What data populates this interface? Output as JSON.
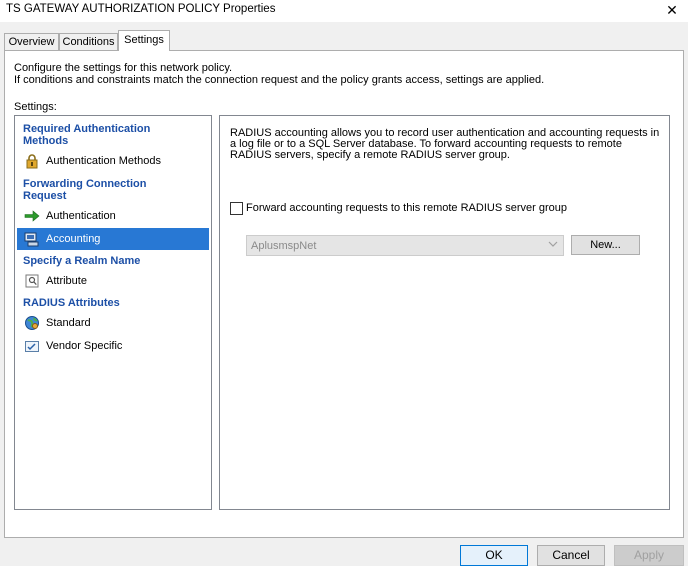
{
  "window": {
    "title": "TS GATEWAY AUTHORIZATION POLICY Properties",
    "close_glyph": "✕"
  },
  "tabs": [
    {
      "label": "Overview"
    },
    {
      "label": "Conditions"
    },
    {
      "label": "Settings",
      "active": true
    }
  ],
  "settings_page": {
    "description_line1": "Configure the settings for this network policy.",
    "description_line2": "If conditions and constraints match the connection request and the policy grants access, settings are applied.",
    "settings_label": "Settings:"
  },
  "sidebar": {
    "groups": [
      {
        "label_line1": "Required Authentication",
        "label_line2": "Methods"
      },
      {
        "label_line1": "Forwarding Connection",
        "label_line2": "Request"
      },
      {
        "label": "Specify a Realm Name"
      },
      {
        "label": "RADIUS Attributes"
      }
    ],
    "items": [
      {
        "label": "Authentication Methods",
        "icon": "lock-icon"
      },
      {
        "label": "Authentication",
        "icon": "green-arrow-icon"
      },
      {
        "label": "Accounting",
        "icon": "computer-icon",
        "selected": true
      },
      {
        "label": "Attribute",
        "icon": "attribute-icon"
      },
      {
        "label": "Standard",
        "icon": "globe-icon"
      },
      {
        "label": "Vendor Specific",
        "icon": "checklist-icon"
      }
    ]
  },
  "accounting": {
    "info": "RADIUS accounting allows you to record user authentication and accounting requests in a log file or to a SQL Server database. To forward accounting requests to remote RADIUS servers, specify a remote RADIUS server group.",
    "forward_checkbox_label": "Forward accounting requests to this remote RADIUS server group",
    "forward_checked": false,
    "server_group_value": "AplusmspNet",
    "new_button": "New..."
  },
  "footer": {
    "ok": "OK",
    "cancel": "Cancel",
    "apply": "Apply"
  },
  "colors": {
    "group_heading": "#1c4fa6",
    "selection": "#2878d4",
    "ok_border": "#0078d7"
  }
}
